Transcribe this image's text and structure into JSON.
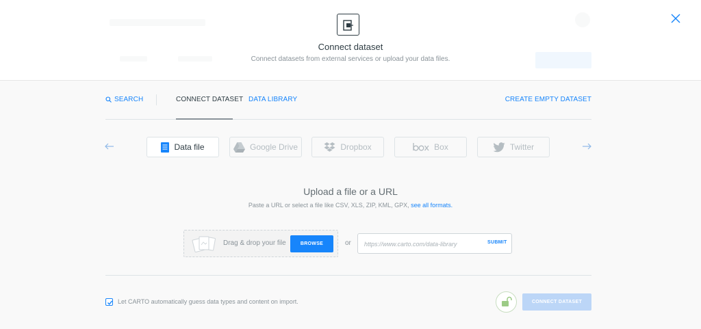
{
  "dialog": {
    "title": "Connect dataset",
    "subtitle": "Connect datasets from external services or upload your data files."
  },
  "tabs": {
    "search": "SEARCH",
    "connect": "CONNECT DATASET",
    "library": "DATA LIBRARY",
    "create": "CREATE EMPTY DATASET"
  },
  "services": [
    {
      "label": "Data file",
      "icon": "data-file-icon"
    },
    {
      "label": "Google Drive",
      "icon": "google-drive-icon"
    },
    {
      "label": "Dropbox",
      "icon": "dropbox-icon"
    },
    {
      "label": "Box",
      "icon": "box-icon"
    },
    {
      "label": "Twitter",
      "icon": "twitter-icon"
    }
  ],
  "upload": {
    "title": "Upload a file or a URL",
    "subtitle": "Paste a URL or select a file like CSV, XLS, ZIP, KML, GPX,",
    "formats_link": "see all formats.",
    "dropzone_text": "Drag & drop your file",
    "browse_label": "BROWSE",
    "or_text": "or",
    "url_placeholder": "https://www.carto.com/data-library",
    "url_value": "",
    "submit_label": "SUBMIT"
  },
  "footer": {
    "guess_label": "Let CARTO automatically guess data types and content on import.",
    "guess_checked": true,
    "connect_label": "CONNECT DATASET"
  },
  "colors": {
    "accent": "#1785fb",
    "disabled_button": "#bcd6f7",
    "text_dark": "#2e3c43",
    "text_muted": "#8a9399"
  }
}
